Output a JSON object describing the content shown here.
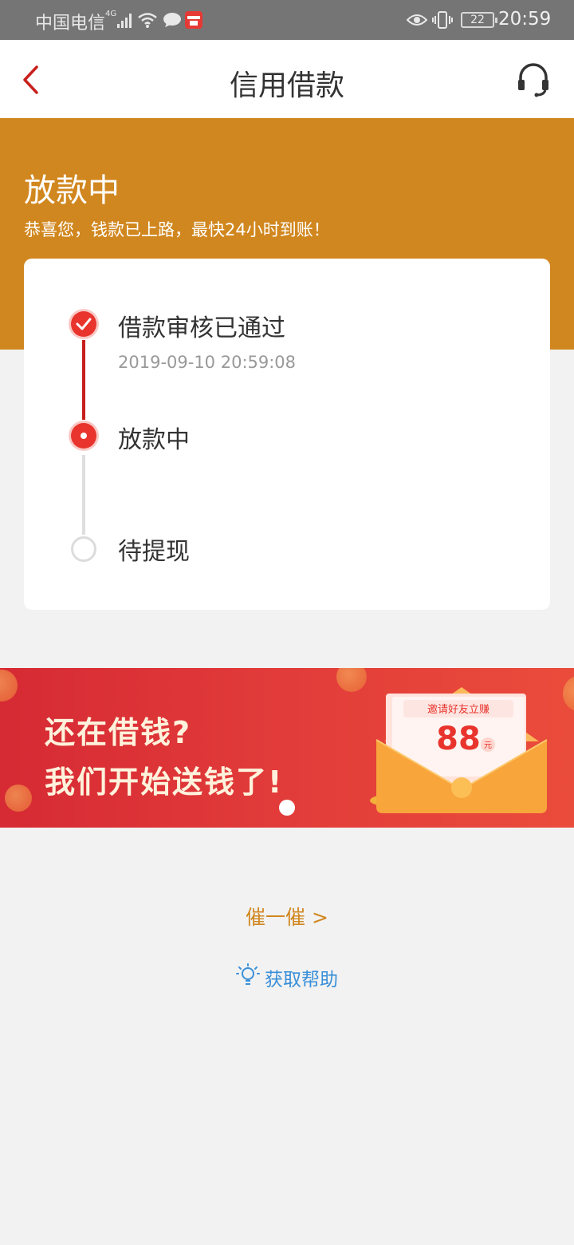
{
  "status_bar": {
    "carrier": "中国电信",
    "network": "4G",
    "battery": "22",
    "time": "20:59"
  },
  "header": {
    "title": "信用借款",
    "back_icon": "chevron-left-icon",
    "service_icon": "headset-icon"
  },
  "loan_status": {
    "title": "放款中",
    "description": "恭喜您，钱款已上路，最快24小时到账！"
  },
  "steps": [
    {
      "label": "借款审核已通过",
      "time": "2019-09-10 20:59:08",
      "state": "done"
    },
    {
      "label": "放款中",
      "time": "",
      "state": "active"
    },
    {
      "label": "待提现",
      "time": "",
      "state": "pending"
    }
  ],
  "promo": {
    "line1": "还在借钱?",
    "line2": "我们开始送钱了!",
    "invite_text": "邀请好友立赚",
    "amount": "88",
    "unit": "元"
  },
  "actions": {
    "urge": "催一催 >",
    "help": "获取帮助"
  },
  "colors": {
    "accent_orange": "#d1871f",
    "accent_red": "#e8342d",
    "link_blue": "#3a8fd8"
  }
}
